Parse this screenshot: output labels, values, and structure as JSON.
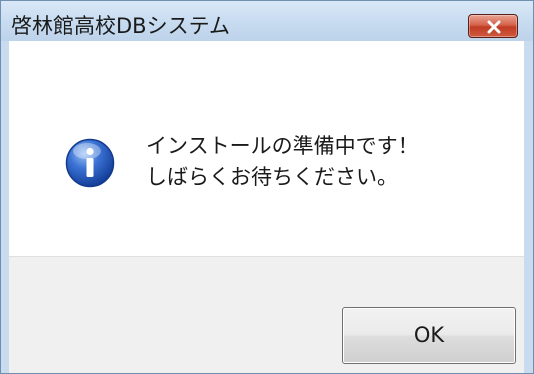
{
  "window": {
    "title": "啓林館高校DBシステム"
  },
  "message": {
    "line1": "インストールの準備中です！",
    "line2": "しばらくお待ちください。"
  },
  "buttons": {
    "ok_label": "OK"
  },
  "icons": {
    "message_icon": "information-icon",
    "close_icon": "close-icon"
  },
  "colors": {
    "titlebar": "#c7dbf0",
    "close_button": "#c9472e",
    "footer": "#f0f0f0",
    "info_icon": "#2f63c4"
  }
}
